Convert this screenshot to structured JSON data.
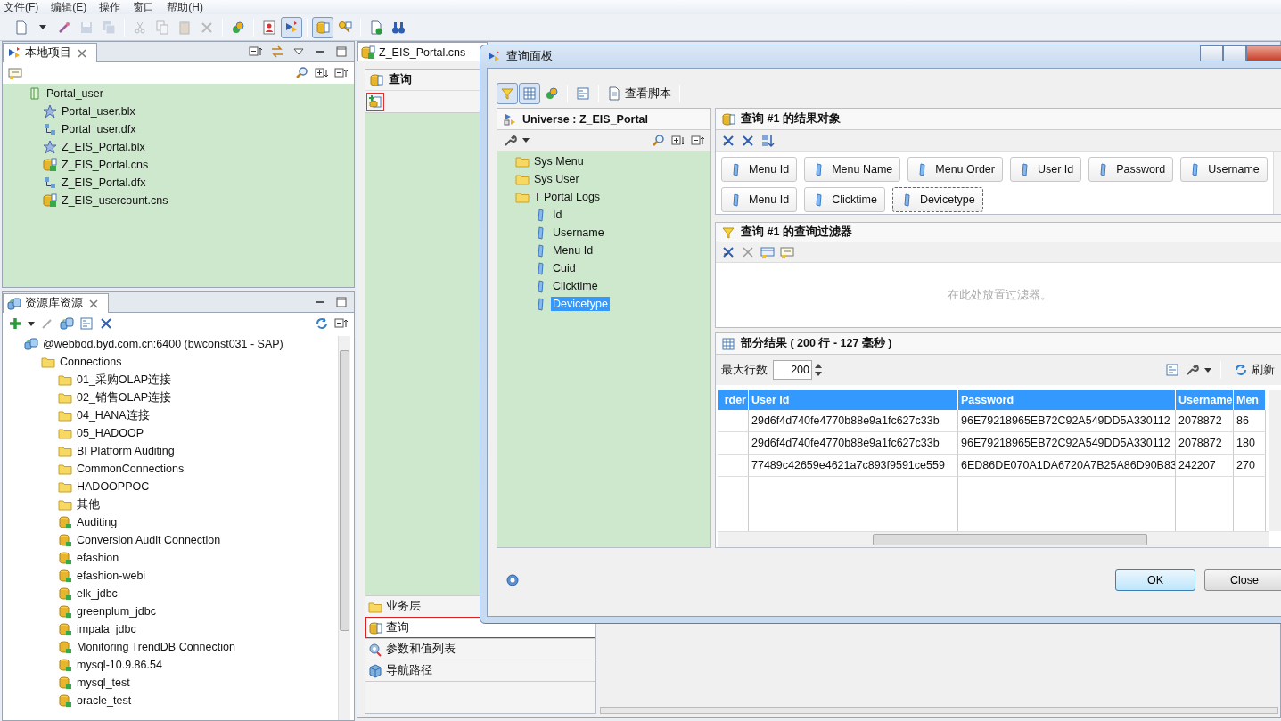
{
  "menu": [
    {
      "label": "文件(F)"
    },
    {
      "label": "编辑(E)"
    },
    {
      "label": "操作"
    },
    {
      "label": "窗口"
    },
    {
      "label": "帮助(H)"
    }
  ],
  "toolbar": [
    {
      "kind": "new",
      "disabled": false,
      "pressed": false
    },
    {
      "kind": "caret",
      "disabled": false,
      "pressed": false
    },
    {
      "kind": "wand",
      "disabled": false,
      "pressed": false
    },
    {
      "kind": "save",
      "disabled": true,
      "pressed": false
    },
    {
      "kind": "save_all",
      "disabled": true,
      "pressed": false
    },
    {
      "kind": "separator"
    },
    {
      "kind": "cut",
      "disabled": true,
      "pressed": false
    },
    {
      "kind": "copy",
      "disabled": true,
      "pressed": false
    },
    {
      "kind": "paste",
      "disabled": true,
      "pressed": false
    },
    {
      "kind": "delete",
      "disabled": true,
      "pressed": false
    },
    {
      "kind": "separator"
    },
    {
      "kind": "link",
      "disabled": false,
      "pressed": false
    },
    {
      "kind": "separator"
    },
    {
      "kind": "person",
      "disabled": false,
      "pressed": false
    },
    {
      "kind": "arrows",
      "disabled": false,
      "pressed": true
    },
    {
      "kind": "separator"
    },
    {
      "kind": "db",
      "disabled": false,
      "pressed": true
    },
    {
      "kind": "key",
      "disabled": false,
      "pressed": false
    },
    {
      "kind": "separator"
    },
    {
      "kind": "check",
      "disabled": false,
      "pressed": false
    },
    {
      "kind": "binoculars",
      "disabled": false,
      "pressed": false
    }
  ],
  "project_panel": {
    "title": "本地项目",
    "tree": [
      {
        "label": "Portal_user",
        "kind": "project",
        "children": [
          {
            "label": "Portal_user.blx",
            "kind": "blx"
          },
          {
            "label": "Portal_user.dfx",
            "kind": "dfx"
          },
          {
            "label": "Z_EIS_Portal.blx",
            "kind": "blx"
          },
          {
            "label": "Z_EIS_Portal.cns",
            "kind": "cns"
          },
          {
            "label": "Z_EIS_Portal.dfx",
            "kind": "dfx"
          },
          {
            "label": "Z_EIS_usercount.cns",
            "kind": "cns"
          }
        ]
      }
    ]
  },
  "repo_panel": {
    "title": "资源库资源",
    "tree": [
      {
        "label": "@webbod.byd.com.cn:6400 (bwconst031 - SAP)",
        "kind": "server",
        "children": [
          {
            "label": "Connections",
            "kind": "folder",
            "children": [
              {
                "label": "01_采购OLAP连接",
                "kind": "folder"
              },
              {
                "label": "02_销售OLAP连接",
                "kind": "folder"
              },
              {
                "label": "04_HANA连接",
                "kind": "folder"
              },
              {
                "label": "05_HADOOP",
                "kind": "folder"
              },
              {
                "label": "BI Platform Auditing",
                "kind": "folder"
              },
              {
                "label": "CommonConnections",
                "kind": "folder"
              },
              {
                "label": "HADOOPPOC",
                "kind": "folder"
              },
              {
                "label": "其他",
                "kind": "folder"
              },
              {
                "label": "Auditing",
                "kind": "conn"
              },
              {
                "label": "Conversion Audit Connection",
                "kind": "conn"
              },
              {
                "label": "efashion",
                "kind": "conn"
              },
              {
                "label": "efashion-webi",
                "kind": "conn"
              },
              {
                "label": "elk_jdbc",
                "kind": "conn"
              },
              {
                "label": "greenplum_jdbc",
                "kind": "conn"
              },
              {
                "label": "impala_jdbc",
                "kind": "conn"
              },
              {
                "label": "Monitoring TrendDB Connection",
                "kind": "conn"
              },
              {
                "label": "mysql-10.9.86.54",
                "kind": "conn"
              },
              {
                "label": "mysql_test",
                "kind": "conn"
              },
              {
                "label": "oracle_test",
                "kind": "conn"
              }
            ]
          }
        ]
      }
    ]
  },
  "editor": {
    "tab": "Z_EIS_Portal.cns",
    "section": "查询",
    "nav": [
      {
        "label": "业务层",
        "kind": "folder",
        "selected": false
      },
      {
        "label": "查询",
        "kind": "db",
        "selected": true
      },
      {
        "label": "参数和值列表",
        "kind": "param",
        "selected": false
      },
      {
        "label": "导航路径",
        "kind": "nav",
        "selected": false
      }
    ]
  },
  "dialog": {
    "title": "查询面板",
    "toolbar": [
      {
        "kind": "filter",
        "pressed": true
      },
      {
        "kind": "table",
        "pressed": true
      },
      {
        "kind": "link",
        "pressed": false
      },
      {
        "kind": "separator"
      },
      {
        "kind": "properties",
        "pressed": false
      },
      {
        "kind": "separator"
      }
    ],
    "script_button": "查看脚本",
    "universe": {
      "title": "Universe : Z_EIS_Portal",
      "tree": [
        {
          "label": "Sys Menu",
          "kind": "folder",
          "selected": false
        },
        {
          "label": "Sys User",
          "kind": "folder",
          "selected": false
        },
        {
          "label": "T Portal Logs",
          "kind": "folder",
          "selected": false,
          "children": [
            {
              "label": "Id",
              "kind": "obj",
              "selected": false
            },
            {
              "label": "Username",
              "kind": "obj",
              "selected": false
            },
            {
              "label": "Menu Id",
              "kind": "obj",
              "selected": false
            },
            {
              "label": "Cuid",
              "kind": "obj",
              "selected": false
            },
            {
              "label": "Clicktime",
              "kind": "obj",
              "selected": false
            },
            {
              "label": "Devicetype",
              "kind": "obj",
              "selected": true
            }
          ]
        }
      ]
    },
    "result_objects": {
      "title": "查询 #1 的结果对象",
      "items": [
        {
          "label": "Menu Id",
          "focused": false
        },
        {
          "label": "Menu Name",
          "focused": false
        },
        {
          "label": "Menu Order",
          "focused": false
        },
        {
          "label": "User Id",
          "focused": false
        },
        {
          "label": "Password",
          "focused": false
        },
        {
          "label": "Username",
          "focused": false
        },
        {
          "label": "Menu Id",
          "focused": false
        },
        {
          "label": "Clicktime",
          "focused": false
        },
        {
          "label": "Devicetype",
          "focused": true
        }
      ]
    },
    "filters": {
      "title": "查询 #1 的查询过滤器",
      "hint": "在此处放置过滤器。"
    },
    "results": {
      "title": "部分结果 ( 200 行  -  127 毫秒 )",
      "max_rows_label": "最大行数",
      "max_rows": "200",
      "refresh": "刷新",
      "columns": [
        "rder",
        "User Id",
        "Password",
        "Username",
        "Men"
      ],
      "rows": [
        [
          null,
          "29d6f4d740fe4770b88e9a1fc627c33b",
          "96E79218965EB72C92A549DD5A330112",
          "2078872",
          "86"
        ],
        [
          null,
          "29d6f4d740fe4770b88e9a1fc627c33b",
          "96E79218965EB72C92A549DD5A330112",
          "2078872",
          "180"
        ],
        [
          null,
          "77489c42659e4621a7c893f9591ce559",
          "6ED86DE070A1DA6720A7B25A86D90B83",
          "242207",
          "270"
        ]
      ]
    },
    "ok": "OK",
    "close": "Close"
  }
}
